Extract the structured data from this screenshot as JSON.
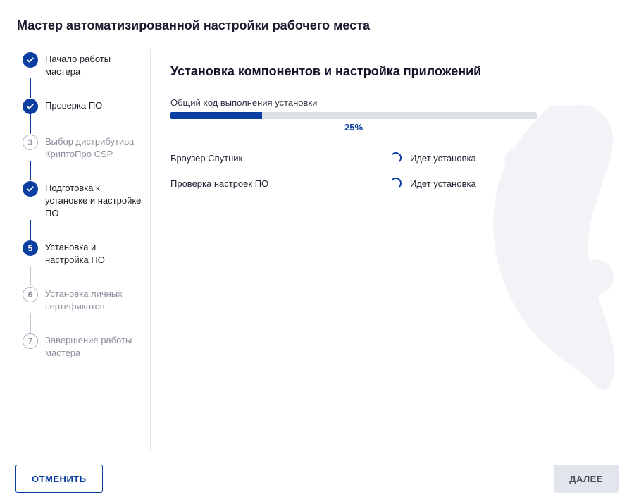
{
  "wizard_title": "Мастер автоматизированной настройки рабочего места",
  "sidebar": {
    "steps": [
      {
        "label": "Начало работы мастера",
        "state": "done"
      },
      {
        "label": "Проверка ПО",
        "state": "done"
      },
      {
        "label": "Выбор дистрибутива КриптоПро CSP",
        "number": "3",
        "state": "disabled"
      },
      {
        "label": "Подготовка к установке и настройке ПО",
        "state": "done"
      },
      {
        "label": "Установка и настройка ПО",
        "number": "5",
        "state": "current"
      },
      {
        "label": "Установка личных сертификатов",
        "number": "6",
        "state": "disabled"
      },
      {
        "label": "Завершение работы мастера",
        "number": "7",
        "state": "disabled"
      }
    ]
  },
  "main": {
    "title": "Установка компонентов и настройка приложений",
    "progress_label": "Общий ход выполнения установки",
    "progress_percent": "25%",
    "progress_value": 25,
    "items": [
      {
        "name": "Браузер Спутник",
        "status": "Идет установка"
      },
      {
        "name": "Проверка настроек ПО",
        "status": "Идет установка"
      }
    ]
  },
  "footer": {
    "cancel": "ОТМЕНИТЬ",
    "next": "ДАЛЕЕ"
  },
  "colors": {
    "primary": "#0a3ea0",
    "muted": "#8a8f9c",
    "progress_bg": "#dcdfe6"
  }
}
